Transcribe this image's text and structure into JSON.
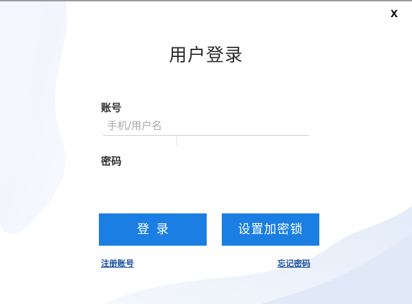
{
  "window": {
    "close_label": "X"
  },
  "login": {
    "title": "用户登录",
    "account_label": "账号",
    "account_placeholder": "手机/用户名",
    "account_value": "",
    "password_label": "密码",
    "password_value": "",
    "login_button_label": "登录",
    "encrypt_lock_button_label": "设置加密锁",
    "register_link": "注册账号",
    "forgot_password_link": "忘记密码"
  },
  "colors": {
    "primary_button": "#1a7ee2",
    "link": "#1a4f9c",
    "background_wave": "#e8f0fb"
  }
}
